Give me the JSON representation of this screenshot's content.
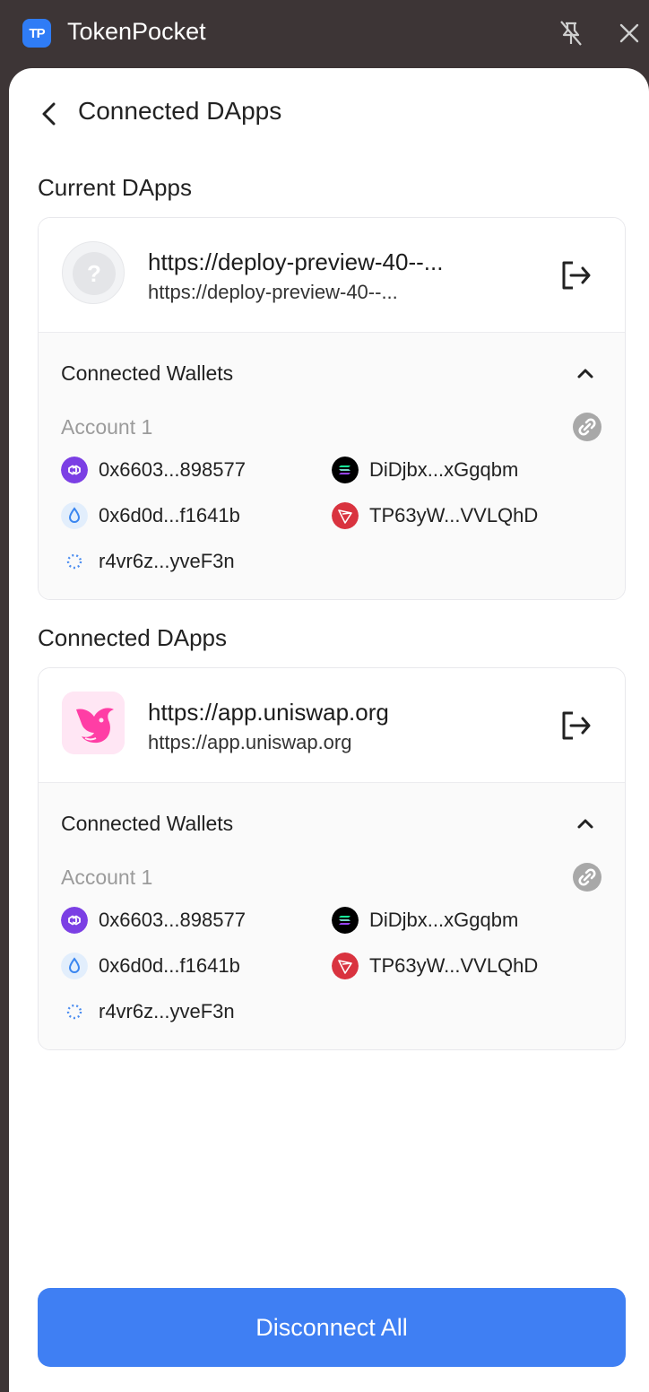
{
  "app": {
    "title": "TokenPocket",
    "logo_text": "TP"
  },
  "page": {
    "title": "Connected DApps"
  },
  "sections": [
    {
      "title": "Current DApps",
      "dapp": {
        "name": "https://deploy-preview-40--...",
        "url": "https://deploy-preview-40--...",
        "icon": "unknown-dapp-icon"
      },
      "wallets_title": "Connected Wallets",
      "account": "Account 1",
      "addresses": [
        {
          "chain": "polygon",
          "text": "0x6603...898577"
        },
        {
          "chain": "solana",
          "text": "DiDjbx...xGgqbm"
        },
        {
          "chain": "eth-drop",
          "text": "0x6d0d...f1641b"
        },
        {
          "chain": "tron",
          "text": "TP63yW...VVLQhD"
        },
        {
          "chain": "ripple",
          "text": "r4vr6z...yveF3n"
        }
      ]
    },
    {
      "title": "Connected DApps",
      "dapp": {
        "name": "https://app.uniswap.org",
        "url": "https://app.uniswap.org",
        "icon": "uniswap-icon"
      },
      "wallets_title": "Connected Wallets",
      "account": "Account 1",
      "addresses": [
        {
          "chain": "polygon",
          "text": "0x6603...898577"
        },
        {
          "chain": "solana",
          "text": "DiDjbx...xGgqbm"
        },
        {
          "chain": "eth-drop",
          "text": "0x6d0d...f1641b"
        },
        {
          "chain": "tron",
          "text": "TP63yW...VVLQhD"
        },
        {
          "chain": "ripple",
          "text": "r4vr6z...yveF3n"
        }
      ]
    }
  ],
  "footer": {
    "disconnect_all": "Disconnect All"
  },
  "colors": {
    "accent": "#3f7ff3",
    "polygon": "#7b3fe4",
    "tron": "#d9333f",
    "solana": "#000000",
    "titlebar": "#3d3536"
  }
}
